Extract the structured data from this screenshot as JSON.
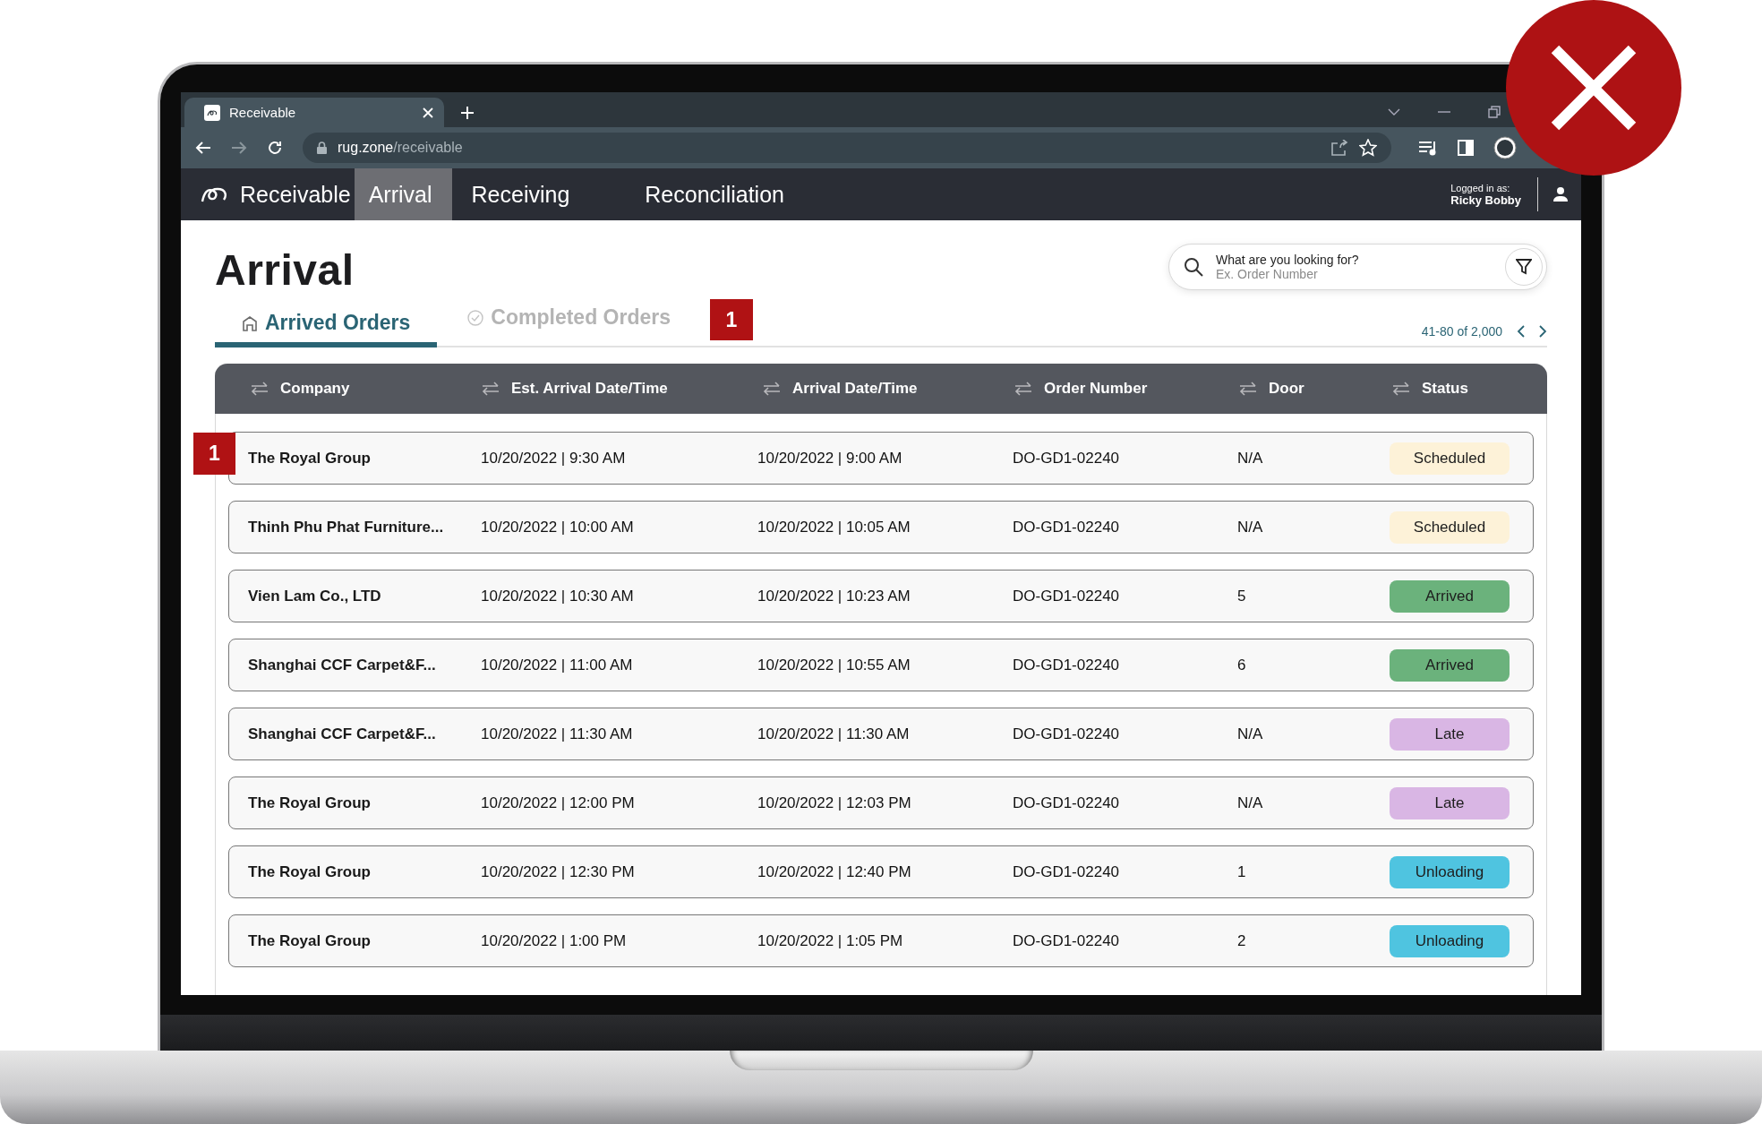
{
  "browser": {
    "tab_title": "Receivable",
    "url_host": "rug.zone",
    "url_path": "/receivable"
  },
  "nav": {
    "brand": "Receivable",
    "items": [
      {
        "label": "Arrival",
        "selected": true
      },
      {
        "label": "Receiving",
        "selected": false
      },
      {
        "label": "Reconciliation",
        "selected": false
      }
    ],
    "user_caption": "Logged in as:",
    "user_name": "Ricky Bobby"
  },
  "page": {
    "title": "Arrival",
    "tabs": [
      {
        "label": "Arrived Orders",
        "kind": "home",
        "selected": true
      },
      {
        "label": "Completed Orders",
        "kind": "check",
        "selected": false
      }
    ],
    "tabs_badge": "1",
    "search": {
      "label": "What are you looking for?",
      "placeholder": "Ex. Order Number"
    },
    "pagination": "41-80 of 2,000"
  },
  "table": {
    "columns": [
      "Company",
      "Est. Arrival Date/Time",
      "Arrival Date/Time",
      "Order Number",
      "Door",
      "Status"
    ],
    "rows": [
      {
        "badge": "1",
        "cells": [
          "The Royal Group",
          "10/20/2022 | 9:30 AM",
          "10/20/2022 | 9:00 AM",
          "DO-GD1-02240",
          "N/A"
        ],
        "status": {
          "label": "Scheduled",
          "color": "#fdf2d8"
        }
      },
      {
        "cells": [
          "Thinh Phu Phat Furniture...",
          "10/20/2022 | 10:00 AM",
          "10/20/2022 | 10:05 AM",
          "DO-GD1-02240",
          "N/A"
        ],
        "status": {
          "label": "Scheduled",
          "color": "#fdf2d8"
        }
      },
      {
        "cells": [
          "Vien Lam Co., LTD",
          "10/20/2022 | 10:30 AM",
          "10/20/2022 | 10:23 AM",
          "DO-GD1-02240",
          "5"
        ],
        "status": {
          "label": "Arrived",
          "color": "#6bb27c"
        }
      },
      {
        "cells": [
          "Shanghai CCF Carpet&F...",
          "10/20/2022 | 11:00 AM",
          "10/20/2022 | 10:55 AM",
          "DO-GD1-02240",
          "6"
        ],
        "status": {
          "label": "Arrived",
          "color": "#6bb27c"
        }
      },
      {
        "cells": [
          "Shanghai CCF Carpet&F...",
          "10/20/2022 | 11:30 AM",
          "10/20/2022 | 11:30 AM",
          "DO-GD1-02240",
          "N/A"
        ],
        "status": {
          "label": "Late",
          "color": "#d9b6e4"
        }
      },
      {
        "cells": [
          "The Royal Group",
          "10/20/2022 | 12:00 PM",
          "10/20/2022 | 12:03 PM",
          "DO-GD1-02240",
          "N/A"
        ],
        "status": {
          "label": "Late",
          "color": "#d9b6e4"
        }
      },
      {
        "cells": [
          "The Royal Group",
          "10/20/2022 | 12:30 PM",
          "10/20/2022 | 12:40 PM",
          "DO-GD1-02240",
          "1"
        ],
        "status": {
          "label": "Unloading",
          "color": "#4fc4e0"
        }
      },
      {
        "cells": [
          "The Royal Group",
          "10/20/2022 | 1:00 PM",
          "10/20/2022 | 1:05 PM",
          "DO-GD1-02240",
          "2"
        ],
        "status": {
          "label": "Unloading",
          "color": "#4fc4e0"
        }
      }
    ]
  }
}
